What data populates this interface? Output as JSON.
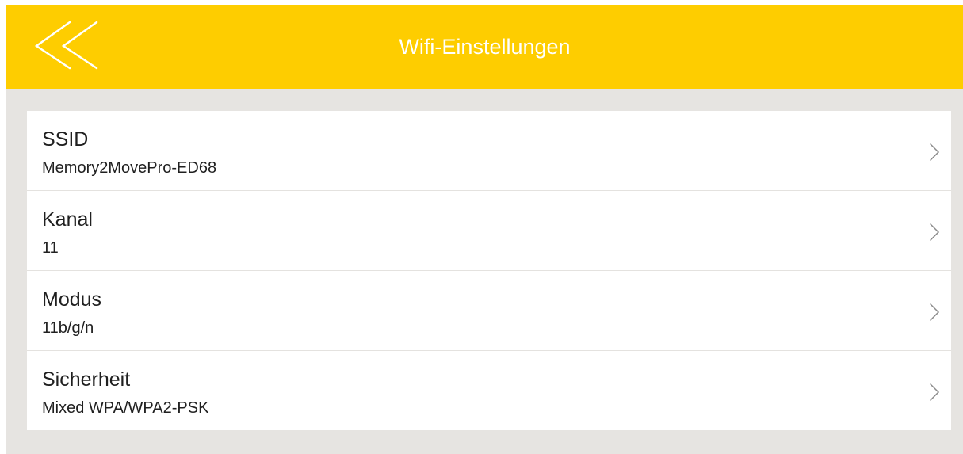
{
  "header": {
    "title": "Wifi-Einstellungen",
    "back_icon": "double-chevron-left-icon",
    "background_color": "#fecd00",
    "text_color": "#ffffff"
  },
  "settings": {
    "items": [
      {
        "label": "SSID",
        "value": "Memory2MovePro-ED68",
        "icon": "chevron-right-icon"
      },
      {
        "label": "Kanal",
        "value": "11",
        "icon": "chevron-right-icon"
      },
      {
        "label": "Modus",
        "value": "11b/g/n",
        "icon": "chevron-right-icon"
      },
      {
        "label": "Sicherheit",
        "value": "Mixed WPA/WPA2-PSK",
        "icon": "chevron-right-icon"
      }
    ]
  },
  "colors": {
    "page_background": "#e6e4e1",
    "list_background": "#ffffff",
    "divider": "#e4e2df",
    "chevron": "#8a8a8a"
  }
}
